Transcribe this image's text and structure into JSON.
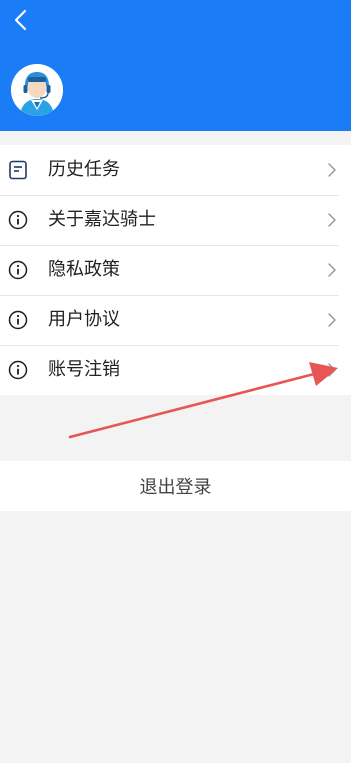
{
  "header": {
    "back_icon": "chevron-left-icon",
    "avatar_icon": "rider-avatar-icon",
    "color": "#1a7cf7"
  },
  "menu": {
    "items": [
      {
        "label": "历史任务",
        "icon": "document-list-icon"
      },
      {
        "label": "关于嘉达骑士",
        "icon": "info-circle-icon"
      },
      {
        "label": "隐私政策",
        "icon": "info-circle-icon"
      },
      {
        "label": "用户协议",
        "icon": "info-circle-icon"
      },
      {
        "label": "账号注销",
        "icon": "info-circle-icon"
      }
    ],
    "chevron_icon": "chevron-right-icon"
  },
  "logout": {
    "label": "退出登录"
  },
  "annotation": {
    "arrow_color": "#e85555"
  }
}
